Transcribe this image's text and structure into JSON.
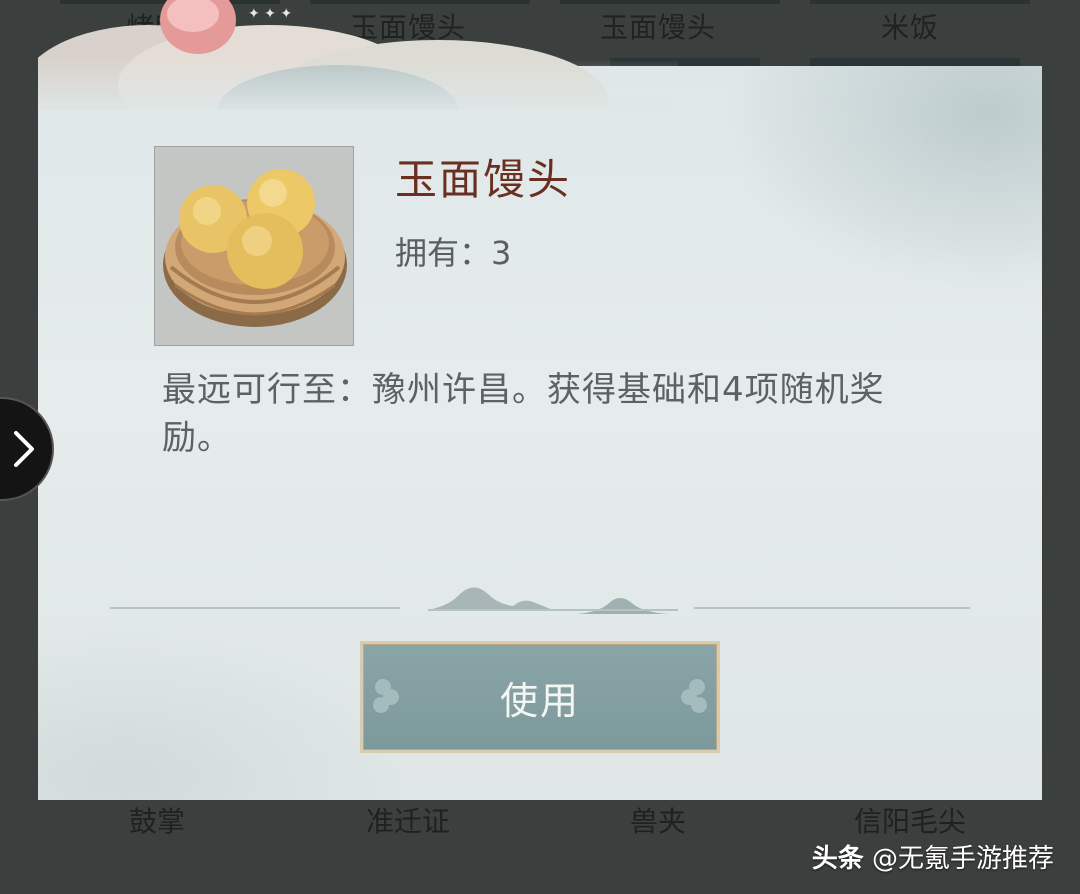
{
  "background": {
    "top_labels": [
      "烤鸭",
      "玉面馒头",
      "玉面馒头",
      "米饭"
    ],
    "bottom_labels": [
      "鼓掌",
      "准迁证",
      "兽夹",
      "信阳毛尖"
    ]
  },
  "item": {
    "name": "玉面馒头",
    "owned_label": "拥有：",
    "owned_count": "3",
    "description": "最远可行至：豫州许昌。获得基础和4项随机奖励。",
    "icon": "steamed-buns-icon"
  },
  "actions": {
    "use_label": "使用"
  },
  "nav": {
    "next_icon": "chevron-right-icon"
  },
  "watermark": {
    "brand": "头条",
    "handle": "@无氪手游推荐"
  },
  "colors": {
    "panel_bg": "#e2e9e9",
    "name_color": "#6b2f22",
    "button_bg": "#7f9c9e",
    "button_border": "#d8ccb0"
  }
}
